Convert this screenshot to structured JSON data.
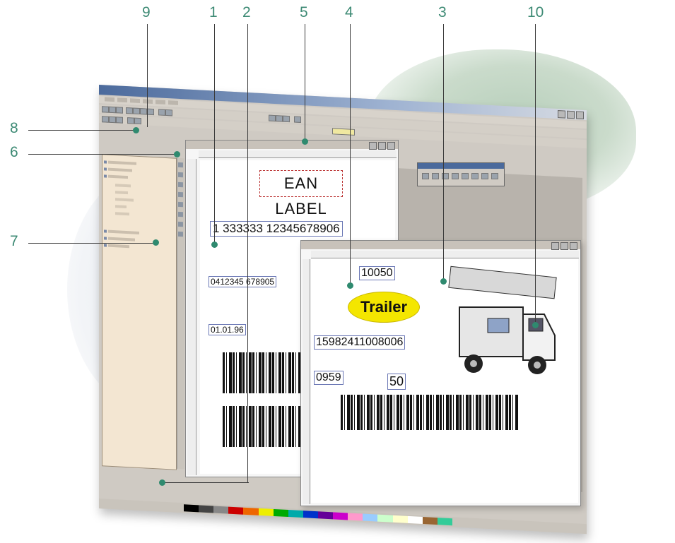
{
  "callouts": {
    "c1": "1",
    "c2": "2",
    "c3": "3",
    "c4": "4",
    "c5": "5",
    "c6": "6",
    "c7": "7",
    "c8": "8",
    "c9": "9",
    "c10": "10"
  },
  "label1": {
    "title": "EAN LABEL",
    "ean_number": "1 333333 12345678906",
    "field_a": "0412345 678905",
    "field_b": "01.01.96"
  },
  "label2": {
    "field_top": "10050",
    "trailer_text": "Trailer",
    "field_mid": "15982411008006",
    "field_left": "0959",
    "field_right": "50"
  },
  "colors": {
    "accent": "#3d8a74",
    "dot": "#2f8a6f",
    "trailer_oval": "#f4e600"
  }
}
